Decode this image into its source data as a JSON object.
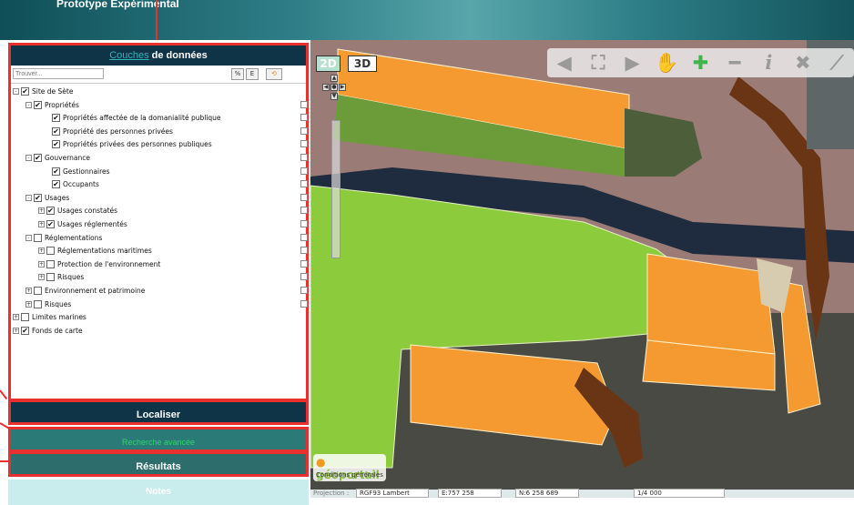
{
  "app": {
    "title": "Prototype Expérimental"
  },
  "layers_panel": {
    "title_accent": "Couches",
    "title_rest": " de données",
    "search_placeholder": "Trouver...",
    "tool_buttons": [
      "%",
      "E"
    ],
    "tree": [
      {
        "label": "Site de Sète",
        "level": 0,
        "checked": true,
        "expander": "-",
        "side": false
      },
      {
        "label": "Propriétés",
        "level": 1,
        "checked": true,
        "expander": "-",
        "side": true
      },
      {
        "label": "Propriétés affectée de la domanialité publique",
        "level": 3,
        "checked": true,
        "expander": "",
        "side": true
      },
      {
        "label": "Propriété des personnes privées",
        "level": 3,
        "checked": true,
        "expander": "",
        "side": true
      },
      {
        "label": "Propriétés privées des personnes publiques",
        "level": 3,
        "checked": true,
        "expander": "",
        "side": true
      },
      {
        "label": "Gouvernance",
        "level": 1,
        "checked": true,
        "expander": "-",
        "side": true
      },
      {
        "label": "Gestionnaires",
        "level": 3,
        "checked": true,
        "expander": "",
        "side": true
      },
      {
        "label": "Occupants",
        "level": 3,
        "checked": true,
        "expander": "",
        "side": true
      },
      {
        "label": "Usages",
        "level": 1,
        "checked": true,
        "expander": "-",
        "side": true
      },
      {
        "label": "Usages constatés",
        "level": 2,
        "checked": true,
        "expander": "+",
        "side": true
      },
      {
        "label": "Usages réglementés",
        "level": 2,
        "checked": true,
        "expander": "+",
        "side": true
      },
      {
        "label": "Réglementations",
        "level": 1,
        "checked": false,
        "expander": "-",
        "side": true
      },
      {
        "label": "Réglementations maritimes",
        "level": 2,
        "checked": false,
        "expander": "+",
        "side": true
      },
      {
        "label": "Protection de l'environnement",
        "level": 2,
        "checked": false,
        "expander": "+",
        "side": true
      },
      {
        "label": "Risques",
        "level": 2,
        "checked": false,
        "expander": "+",
        "side": true
      },
      {
        "label": "Environnement et patrimoine",
        "level": 1,
        "checked": false,
        "expander": "+",
        "side": true
      },
      {
        "label": "Risques",
        "level": 1,
        "checked": false,
        "expander": "+",
        "side": true
      },
      {
        "label": "Limites marines",
        "level": 0,
        "checked": false,
        "expander": "+",
        "side": false
      },
      {
        "label": "Fonds de carte",
        "level": 0,
        "checked": true,
        "expander": "+",
        "side": false
      }
    ]
  },
  "panels": {
    "localiser": "Localiser",
    "advanced": "Recherche avancée",
    "resultats": "Résultats",
    "notes": "Notes"
  },
  "map": {
    "mode_2d": "2D",
    "mode_3d": "3D",
    "toolbar_icons": [
      "arrow-left-icon",
      "full-extent-icon",
      "arrow-right-icon",
      "pan-hand-icon",
      "zoom-in-icon",
      "zoom-out-icon",
      "info-icon",
      "delete-icon",
      "measure-icon"
    ],
    "geoportail_logo": "géoportail",
    "conditions": "Conditions générales"
  },
  "statusbar": {
    "projection_label": "Projection :",
    "projection_value": "RGF93 Lambert",
    "easting": "E:757 258",
    "northing": "N:6 258 689",
    "scale": "1/4 000"
  },
  "colors": {
    "highlight": "#e8312f",
    "panel_dark": "#0f3448",
    "panel_teal": "#2d6d6b",
    "zone_orange": "#f59a30",
    "zone_green": "#8ccb3c",
    "water": "#1f2b3f",
    "land": "#9b7b76"
  }
}
